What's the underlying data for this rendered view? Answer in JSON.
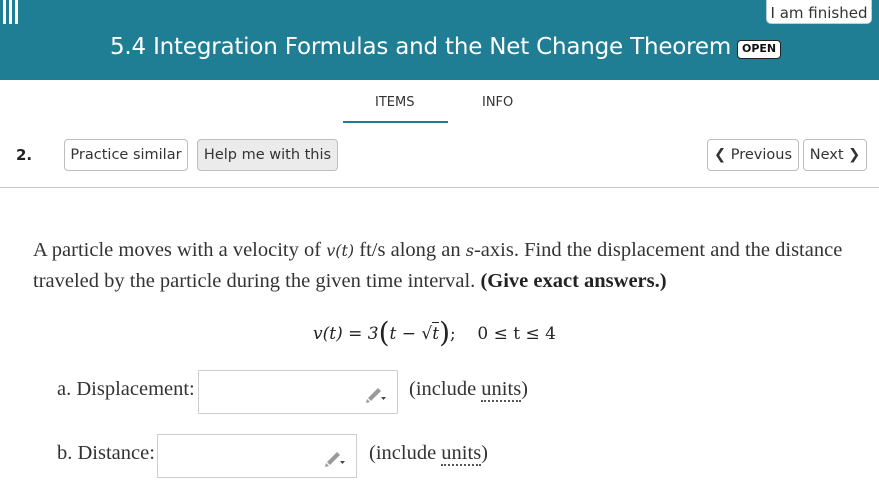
{
  "header": {
    "title": "5.4 Integration Formulas and the Net Change Theorem",
    "status_badge": "OPEN",
    "finished_label": "I am finished",
    "background_color": "#1f7d94",
    "menu_icon": "hamburger-menu-icon"
  },
  "tabs": [
    {
      "label": "ITEMS",
      "active": true
    },
    {
      "label": "INFO",
      "active": false
    }
  ],
  "question_nav": {
    "number": "2.",
    "practice_label": "Practice similar",
    "help_label": "Help me with this",
    "previous_label": "Previous",
    "next_label": "Next"
  },
  "problem": {
    "text_1": "A particle moves with a velocity of ",
    "velocity_symbol": "v(t)",
    "units": " ft/s",
    "text_2": " along an ",
    "axis_symbol": "s",
    "text_3": "-axis. Find the displacement and the distance traveled by the particle during the given time interval. ",
    "emphasis": "(Give exact answers.)",
    "equation": {
      "lhs": "v(t) = 3",
      "open": "(",
      "inner_t": "t − ",
      "sqrt_symbol": "√",
      "sqrt_arg": "t",
      "close": ")",
      "separator": ";",
      "interval": "0 ≤ t ≤ 4"
    }
  },
  "answers": [
    {
      "label": "a. Displacement:",
      "value": "",
      "units_prefix": "(include ",
      "units_link": "units",
      "units_suffix": ")",
      "icon": "pencil-icon"
    },
    {
      "label": "b. Distance:",
      "value": "",
      "units_prefix": "(include ",
      "units_link": "units",
      "units_suffix": ")",
      "icon": "pencil-icon"
    }
  ]
}
